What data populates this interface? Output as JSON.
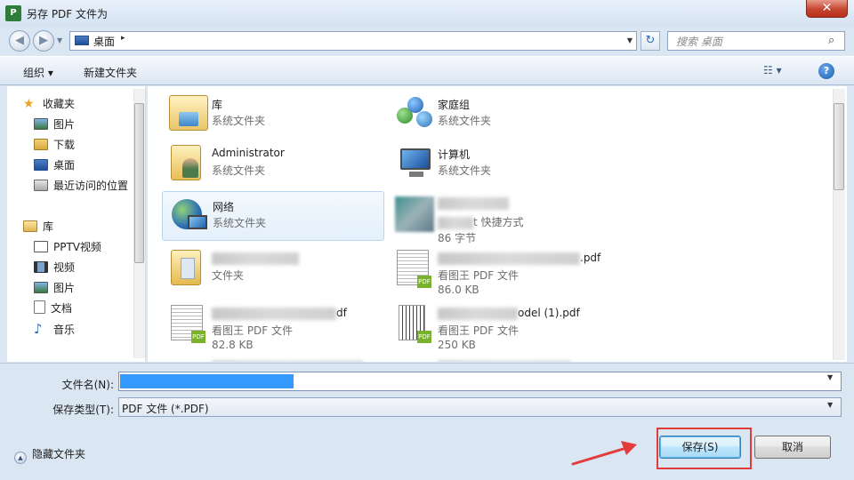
{
  "window": {
    "title": "另存 PDF 文件为",
    "app_badge": "P",
    "close_label": "✕"
  },
  "address": {
    "location": "桌面",
    "sep": "▸",
    "dropdown": "▼",
    "refresh": "↻"
  },
  "search": {
    "placeholder": "搜索 桌面",
    "icon": "⌕"
  },
  "nav_buttons": {
    "back": "◀",
    "forward": "▶",
    "recent": "▼"
  },
  "toolbar": {
    "organize": "组织 ▾",
    "new_folder": "新建文件夹",
    "view": "☷ ▾",
    "help": "?"
  },
  "sidebar": {
    "favorites_header": "收藏夹",
    "favorites": [
      {
        "label": "图片"
      },
      {
        "label": "下载"
      },
      {
        "label": "桌面"
      },
      {
        "label": "最近访问的位置"
      }
    ],
    "libraries_header": "库",
    "libraries": [
      {
        "label": "PPTV视频"
      },
      {
        "label": "视频"
      },
      {
        "label": "图片"
      },
      {
        "label": "文档"
      },
      {
        "label": "音乐"
      }
    ]
  },
  "files": [
    {
      "name": "库",
      "sub": "系统文件夹",
      "icon": "library-folder-icon"
    },
    {
      "name": "家庭组",
      "sub": "系统文件夹",
      "icon": "homegroup-icon"
    },
    {
      "name": "Administrator",
      "sub": "系统文件夹",
      "icon": "user-folder-icon"
    },
    {
      "name": "计算机",
      "sub": "系统文件夹",
      "icon": "computer-icon"
    },
    {
      "name": "网络",
      "sub": "系统文件夹",
      "icon": "network-icon"
    },
    {
      "name": "t 快捷方式",
      "sub": "86 字节",
      "icon": "shortcut-icon"
    },
    {
      "name": "",
      "sub": "文件夹",
      "icon": "folder-icon"
    },
    {
      "name": ".pdf",
      "sub": "看图王 PDF 文件",
      "size": "86.0 KB",
      "icon": "pdf-file-icon"
    },
    {
      "name": "df",
      "sub": "看图王 PDF 文件",
      "size": "82.8 KB",
      "icon": "pdf-file-icon"
    },
    {
      "name": "odel (1).pdf",
      "sub": "看图王 PDF 文件",
      "size": "250 KB",
      "icon": "pdf-file-icon"
    }
  ],
  "form": {
    "filename_label": "文件名(N):",
    "type_label": "保存类型(T):",
    "type_value": "PDF 文件 (*.PDF)",
    "dd": "▼"
  },
  "footer": {
    "hide_folders": "隐藏文件夹",
    "save": "保存(S)",
    "cancel": "取消"
  },
  "colors": {
    "selection": "#3399ff",
    "highlight_box": "#e23b3b",
    "arrow": "#e23b3b"
  }
}
